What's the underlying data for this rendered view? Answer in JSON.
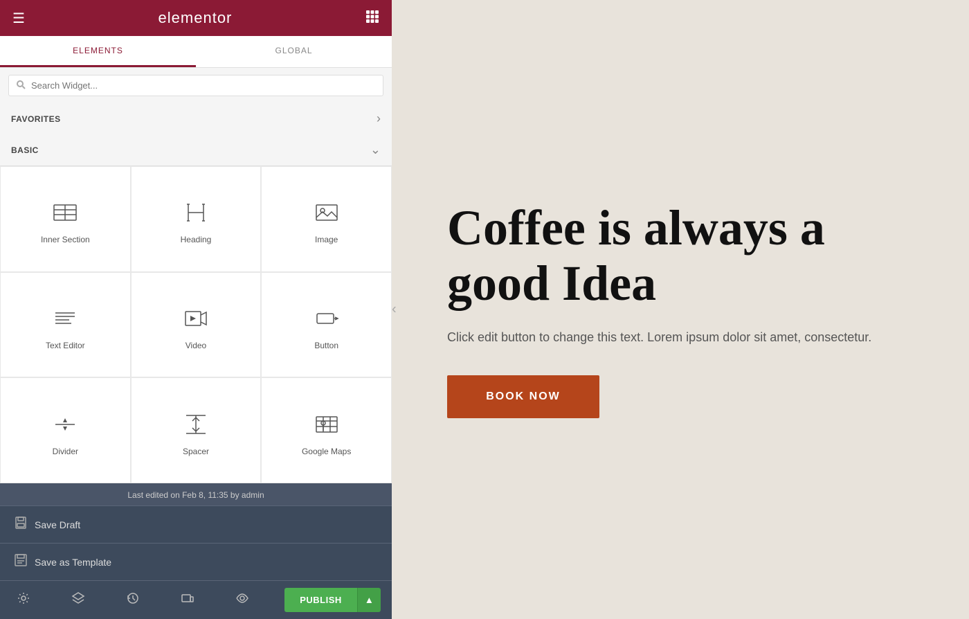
{
  "header": {
    "logo": "elementor",
    "hamburger_icon": "☰",
    "grid_icon": "⊞"
  },
  "tabs": [
    {
      "id": "elements",
      "label": "ELEMENTS",
      "active": true
    },
    {
      "id": "global",
      "label": "GLOBAL",
      "active": false
    }
  ],
  "search": {
    "placeholder": "Search Widget..."
  },
  "favorites": {
    "label": "FAVORITES",
    "chevron": "›"
  },
  "basic": {
    "label": "BASIC",
    "chevron": "⌄"
  },
  "widgets": [
    {
      "id": "inner-section",
      "label": "Inner Section"
    },
    {
      "id": "heading",
      "label": "Heading"
    },
    {
      "id": "image",
      "label": "Image"
    },
    {
      "id": "text-editor",
      "label": "Text Editor"
    },
    {
      "id": "video",
      "label": "Video"
    },
    {
      "id": "button",
      "label": "Button"
    },
    {
      "id": "divider",
      "label": "Divider"
    },
    {
      "id": "spacer",
      "label": "Spacer"
    },
    {
      "id": "google-maps",
      "label": "Google Maps"
    }
  ],
  "bottom_bar": {
    "last_edited": "Last edited on Feb 8, 11:35 by admin",
    "save_draft_label": "Save Draft",
    "save_template_label": "Save as Template"
  },
  "footer": {
    "publish_label": "PUBLISH"
  },
  "canvas": {
    "heading": "Coffee is always a good Idea",
    "subtext": "Click edit button to change this text. Lorem ipsum dolor sit amet, consectetur.",
    "cta_label": "BOOK NOW"
  }
}
